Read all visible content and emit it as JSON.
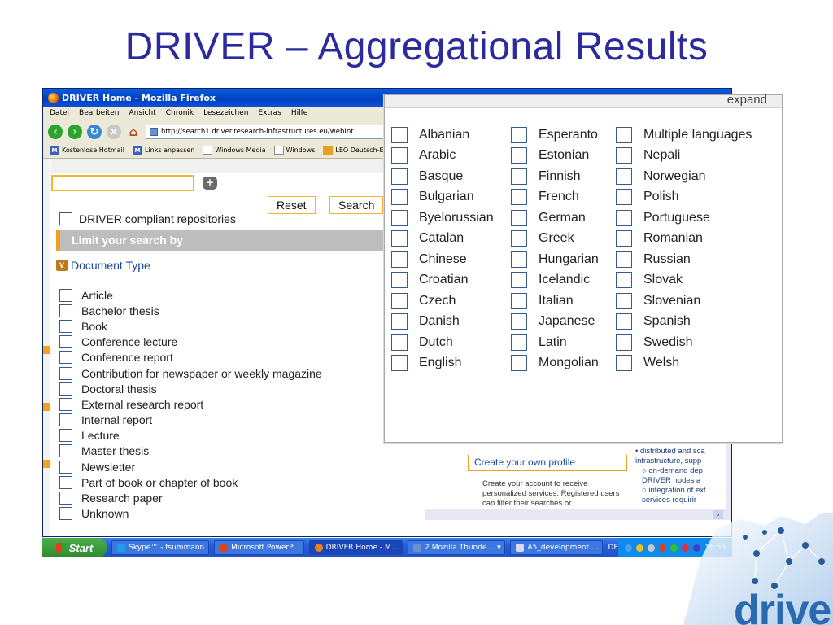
{
  "slide": {
    "title": "DRIVER – Aggregational Results"
  },
  "browser": {
    "title": "DRIVER Home - Mozilla Firefox",
    "menu": [
      "Datei",
      "Bearbeiten",
      "Ansicht",
      "Chronik",
      "Lesezeichen",
      "Extras",
      "Hilfe"
    ],
    "url": "http://search1.driver.research-infrastructures.eu/webInt",
    "bookmarks": [
      "Kostenlose Hotmail",
      "Links anpassen",
      "Windows Media",
      "Windows",
      "LEO Deutsch-Eng"
    ]
  },
  "search": {
    "reset_label": "Reset",
    "search_label": "Search",
    "compliant_label": "DRIVER compliant repositories",
    "limit_label": "Limit your search by",
    "doctype_label": "Document Type",
    "document_types": [
      "Article",
      "Bachelor thesis",
      "Book",
      "Conference lecture",
      "Conference report",
      "Contribution for newspaper or weekly magazine",
      "Doctoral thesis",
      "External research report",
      "Internal report",
      "Lecture",
      "Master thesis",
      "Newsletter",
      "Part of book or chapter of book",
      "Research paper",
      "Unknown"
    ]
  },
  "languages": {
    "expand_label": "expand",
    "col1": [
      "Albanian",
      "Arabic",
      "Basque",
      "Bulgarian",
      "Byelorussian",
      "Catalan",
      "Chinese",
      "Croatian",
      "Czech",
      "Danish",
      "Dutch",
      "English"
    ],
    "col2": [
      "Esperanto",
      "Estonian",
      "Finnish",
      "French",
      "German",
      "Greek",
      "Hungarian",
      "Icelandic",
      "Italian",
      "Japanese",
      "Latin",
      "Mongolian"
    ],
    "col3": [
      "Multiple languages",
      "Nepali",
      "Norwegian",
      "Polish",
      "Portuguese",
      "Romanian",
      "Russian",
      "Slovak",
      "Slovenian",
      "Spanish",
      "Swedish",
      "Welsh"
    ]
  },
  "profile": {
    "title": "Create your own profile",
    "text": "Create your account to receive personalized services. Registered users can filter their searches or",
    "bullets": [
      "distributed and sca infrastructure, supp",
      "on-demand dep DRIVER nodes a",
      "integration of ext services requirir"
    ]
  },
  "taskbar": {
    "start_label": "Start",
    "tasks": [
      "Skype™ - fsummann",
      "Microsoft PowerP...",
      "DRIVER Home - M...",
      "2 Mozilla Thunde...",
      "A5_development...."
    ],
    "lang": "DE",
    "clock": "16:58"
  },
  "logo": {
    "text": "driver"
  },
  "colors": {
    "title": "#2b2b9e",
    "accent": "#f0a020",
    "link": "#1a4a9a",
    "logo": "#2a6ab0"
  }
}
